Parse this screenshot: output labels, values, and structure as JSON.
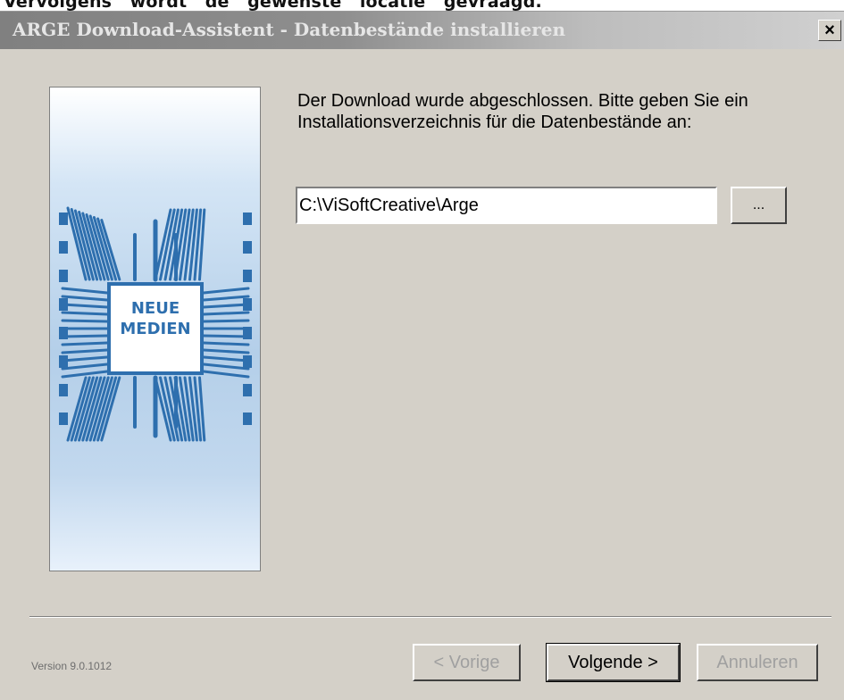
{
  "overlay_caption": "Vervolgens   wordt   de   gewenste   locatie   gevraagd.",
  "window": {
    "title": "ARGE Download-Assistent - Datenbestände installieren",
    "close_label": "×"
  },
  "banner": {
    "logo_line1": "NEUE",
    "logo_line2": "MEDIEN"
  },
  "content": {
    "instruction_line1": "Der Download wurde abgeschlossen. Bitte geben Sie ein",
    "instruction_line2": "Installationsverzeichnis für die Datenbestände an:",
    "path_value": "C:\\ViSoftCreative\\Arge",
    "browse_label": "..."
  },
  "footer": {
    "version": "Version 9.0.1012",
    "back_label": "< Vorige",
    "next_label": "Volgende >",
    "cancel_label": "Annuleren"
  },
  "colors": {
    "dialog_bg": "#d4d0c8",
    "logo_blue": "#2e6fae",
    "disabled_text": "#a0a0a0"
  },
  "icons": {
    "close": "close-icon",
    "logo": "neue-medien-chip-logo"
  }
}
